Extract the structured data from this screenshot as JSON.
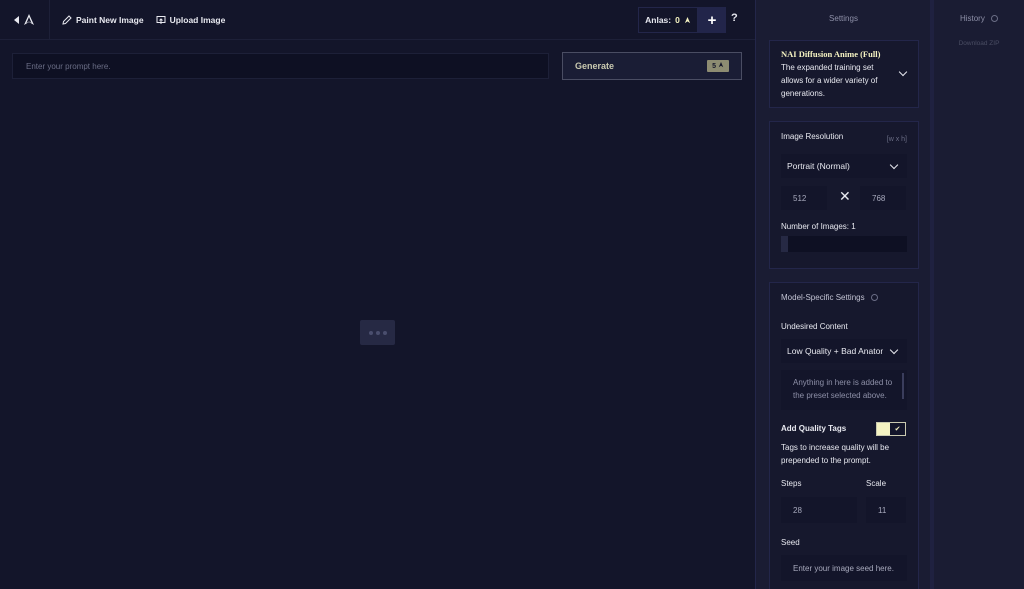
{
  "topbar": {
    "paint_label": "Paint New Image",
    "upload_label": "Upload Image",
    "anlas_label": "Anlas:",
    "anlas_value": "0",
    "help_label": "?"
  },
  "prompt": {
    "placeholder": "Enter your prompt here.",
    "value": ""
  },
  "generate": {
    "label": "Generate",
    "cost": "5"
  },
  "settings": {
    "title": "Settings",
    "model": {
      "name": "NAI Diffusion Anime (Full)",
      "description": "The expanded training set allows for a wider variety of generations."
    },
    "resolution": {
      "label": "Image Resolution",
      "hint": "[w x h]",
      "preset": "Portrait (Normal)",
      "width": "512",
      "height": "768"
    },
    "num_images": {
      "label": "Number of Images:",
      "value": "1",
      "fraction": 0
    },
    "model_specific": {
      "label": "Model-Specific Settings",
      "undesired_label": "Undesired Content",
      "undesired_preset": "Low Quality + Bad Anatomy",
      "undesired_placeholder": "Anything in here is added to the preset selected above.",
      "quality_tags_label": "Add Quality Tags",
      "quality_tags_enabled": true,
      "quality_tags_help": "Tags to increase quality will be prepended to the prompt.",
      "steps_label": "Steps",
      "steps_value": "28",
      "scale_label": "Scale",
      "scale_value": "11",
      "seed_label": "Seed",
      "seed_placeholder": "Enter your image seed here."
    }
  },
  "history": {
    "title": "History",
    "download_label": "Download ZIP"
  },
  "colors": {
    "background": "#13152a",
    "panel": "#1a1c33",
    "accent": "#f5f3c2"
  }
}
